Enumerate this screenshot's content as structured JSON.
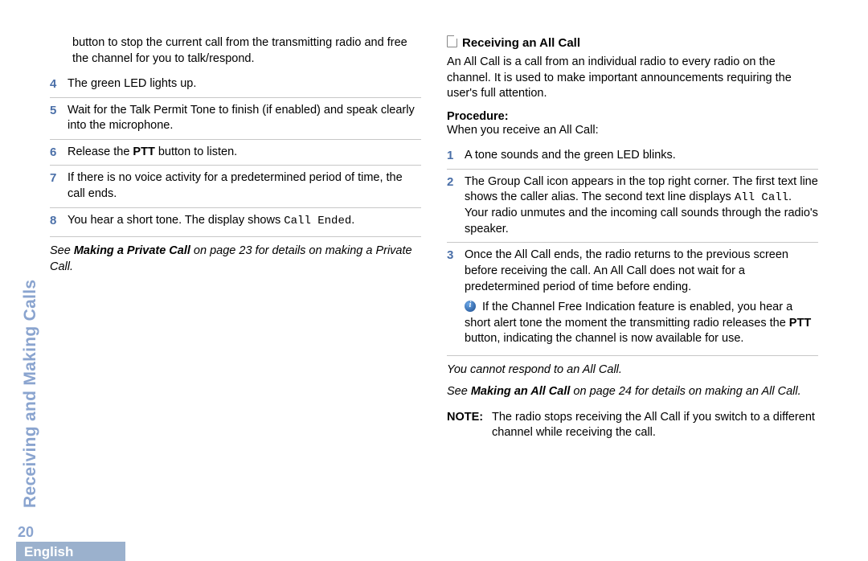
{
  "sidebar": {
    "section_title": "Receiving and Making Calls"
  },
  "page_number": "20",
  "language_tab": "English",
  "left": {
    "intro": "button to stop the current call from the transmitting radio and free the channel for you to talk/respond.",
    "steps": {
      "s4_num": "4",
      "s4": "The green LED lights up.",
      "s5_num": "5",
      "s5": "Wait for the Talk Permit Tone to finish (if enabled) and speak clearly into the microphone.",
      "s6_num": "6",
      "s6_pre": "Release the ",
      "s6_bold": "PTT",
      "s6_post": " button to listen.",
      "s7_num": "7",
      "s7": "If there is no voice activity for a predetermined period of time, the call ends.",
      "s8_num": "8",
      "s8_pre": "You hear a short tone. The display shows ",
      "s8_mono": "Call Ended",
      "s8_post": "."
    },
    "see": {
      "pre": "See ",
      "bold": "Making a Private Call",
      "post": " on page 23 for details on making a Private Call."
    }
  },
  "right": {
    "heading": "Receiving an All Call",
    "desc": "An All Call is a call from an individual radio to every radio on the channel. It is used to make important announcements requiring the user's full attention.",
    "procedure_label": "Procedure:",
    "procedure_intro": "When you receive an All Call:",
    "steps": {
      "s1_num": "1",
      "s1": "A tone sounds and the green LED blinks.",
      "s2_num": "2",
      "s2_a": "The Group Call icon appears in the top right corner. The first text line shows the caller alias. The second text line displays ",
      "s2_mono": "All Call",
      "s2_b": ". Your radio unmutes and the incoming call sounds through the radio's speaker.",
      "s3_num": "3",
      "s3": "Once the All Call ends, the radio returns to the previous screen before receiving the call. An All Call does not wait for a predetermined period of time before ending.",
      "s3_sub_a": "If the Channel Free Indication feature is enabled, you hear a short alert tone the moment the transmitting radio releases the ",
      "s3_sub_bold": "PTT",
      "s3_sub_b": " button, indicating the channel is now available for use."
    },
    "cannot": "You cannot respond to an All Call.",
    "see": {
      "pre": "See ",
      "bold": "Making an All Call",
      "post": " on page 24 for details on making an All Call."
    },
    "note_label": "NOTE:",
    "note_text": "The radio stops receiving the All Call if you switch to a different channel while receiving the call."
  }
}
